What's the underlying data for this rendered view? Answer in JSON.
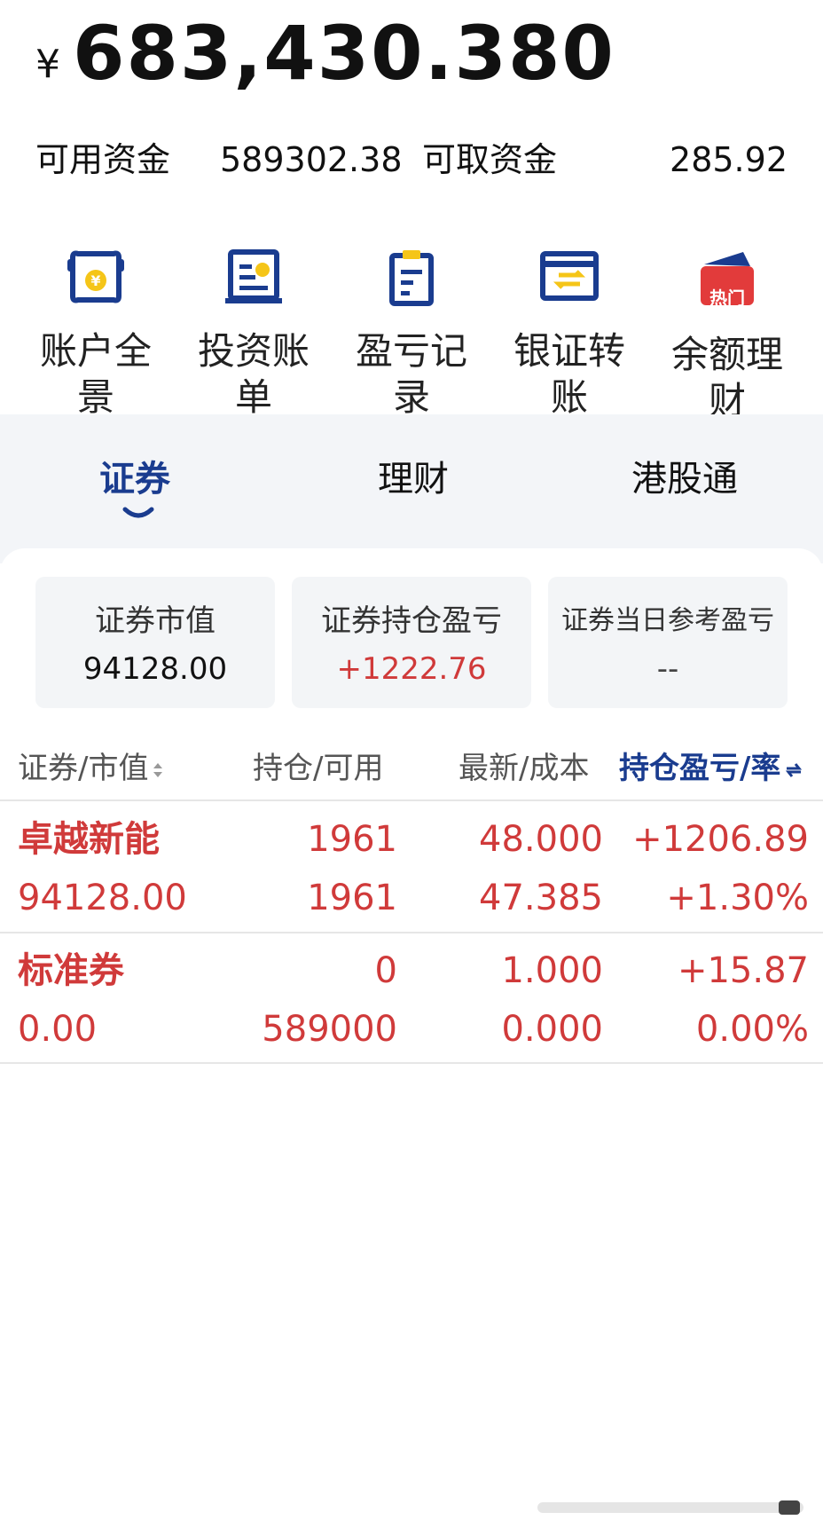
{
  "account": {
    "currency_symbol": "¥",
    "total_assets": "683,430.380",
    "available_label": "可用资金",
    "available_value": "589302.38",
    "withdrawable_label": "可取资金",
    "withdrawable_value": "285.92"
  },
  "quick_actions": [
    {
      "label": "账户全景",
      "icon": "account-overview-icon"
    },
    {
      "label": "投资账单",
      "icon": "invest-bill-icon"
    },
    {
      "label": "盈亏记录",
      "icon": "pnl-record-icon"
    },
    {
      "label": "银证转账",
      "icon": "bank-transfer-icon"
    },
    {
      "label": "余额理财",
      "icon": "wallet-icon",
      "badge": "热门"
    }
  ],
  "tabs": [
    {
      "label": "证券",
      "active": true
    },
    {
      "label": "理财",
      "active": false
    },
    {
      "label": "港股通",
      "active": false
    }
  ],
  "stats": [
    {
      "label": "证券市值",
      "value": "94128.00"
    },
    {
      "label": "证券持仓盈亏",
      "value": "+1222.76"
    },
    {
      "label": "证券当日参考盈亏",
      "value": "--"
    }
  ],
  "table": {
    "headers": [
      "证券/市值",
      "持仓/可用",
      "最新/成本",
      "持仓盈亏/率"
    ],
    "rows": [
      {
        "name": "卓越新能",
        "market_value": "94128.00",
        "position": "1961",
        "available": "1961",
        "latest": "48.000",
        "cost": "47.385",
        "pnl": "+1206.89",
        "pnl_rate": "+1.30%"
      },
      {
        "name": "标准券",
        "market_value": "0.00",
        "position": "0",
        "available": "589000",
        "latest": "1.000",
        "cost": "0.000",
        "pnl": "+15.87",
        "pnl_rate": "0.00%"
      }
    ]
  },
  "colors": {
    "accent": "#1a3c8f",
    "gain": "#d03a3a",
    "icon_yellow": "#f5c518",
    "hot_red": "#e23b3b"
  }
}
